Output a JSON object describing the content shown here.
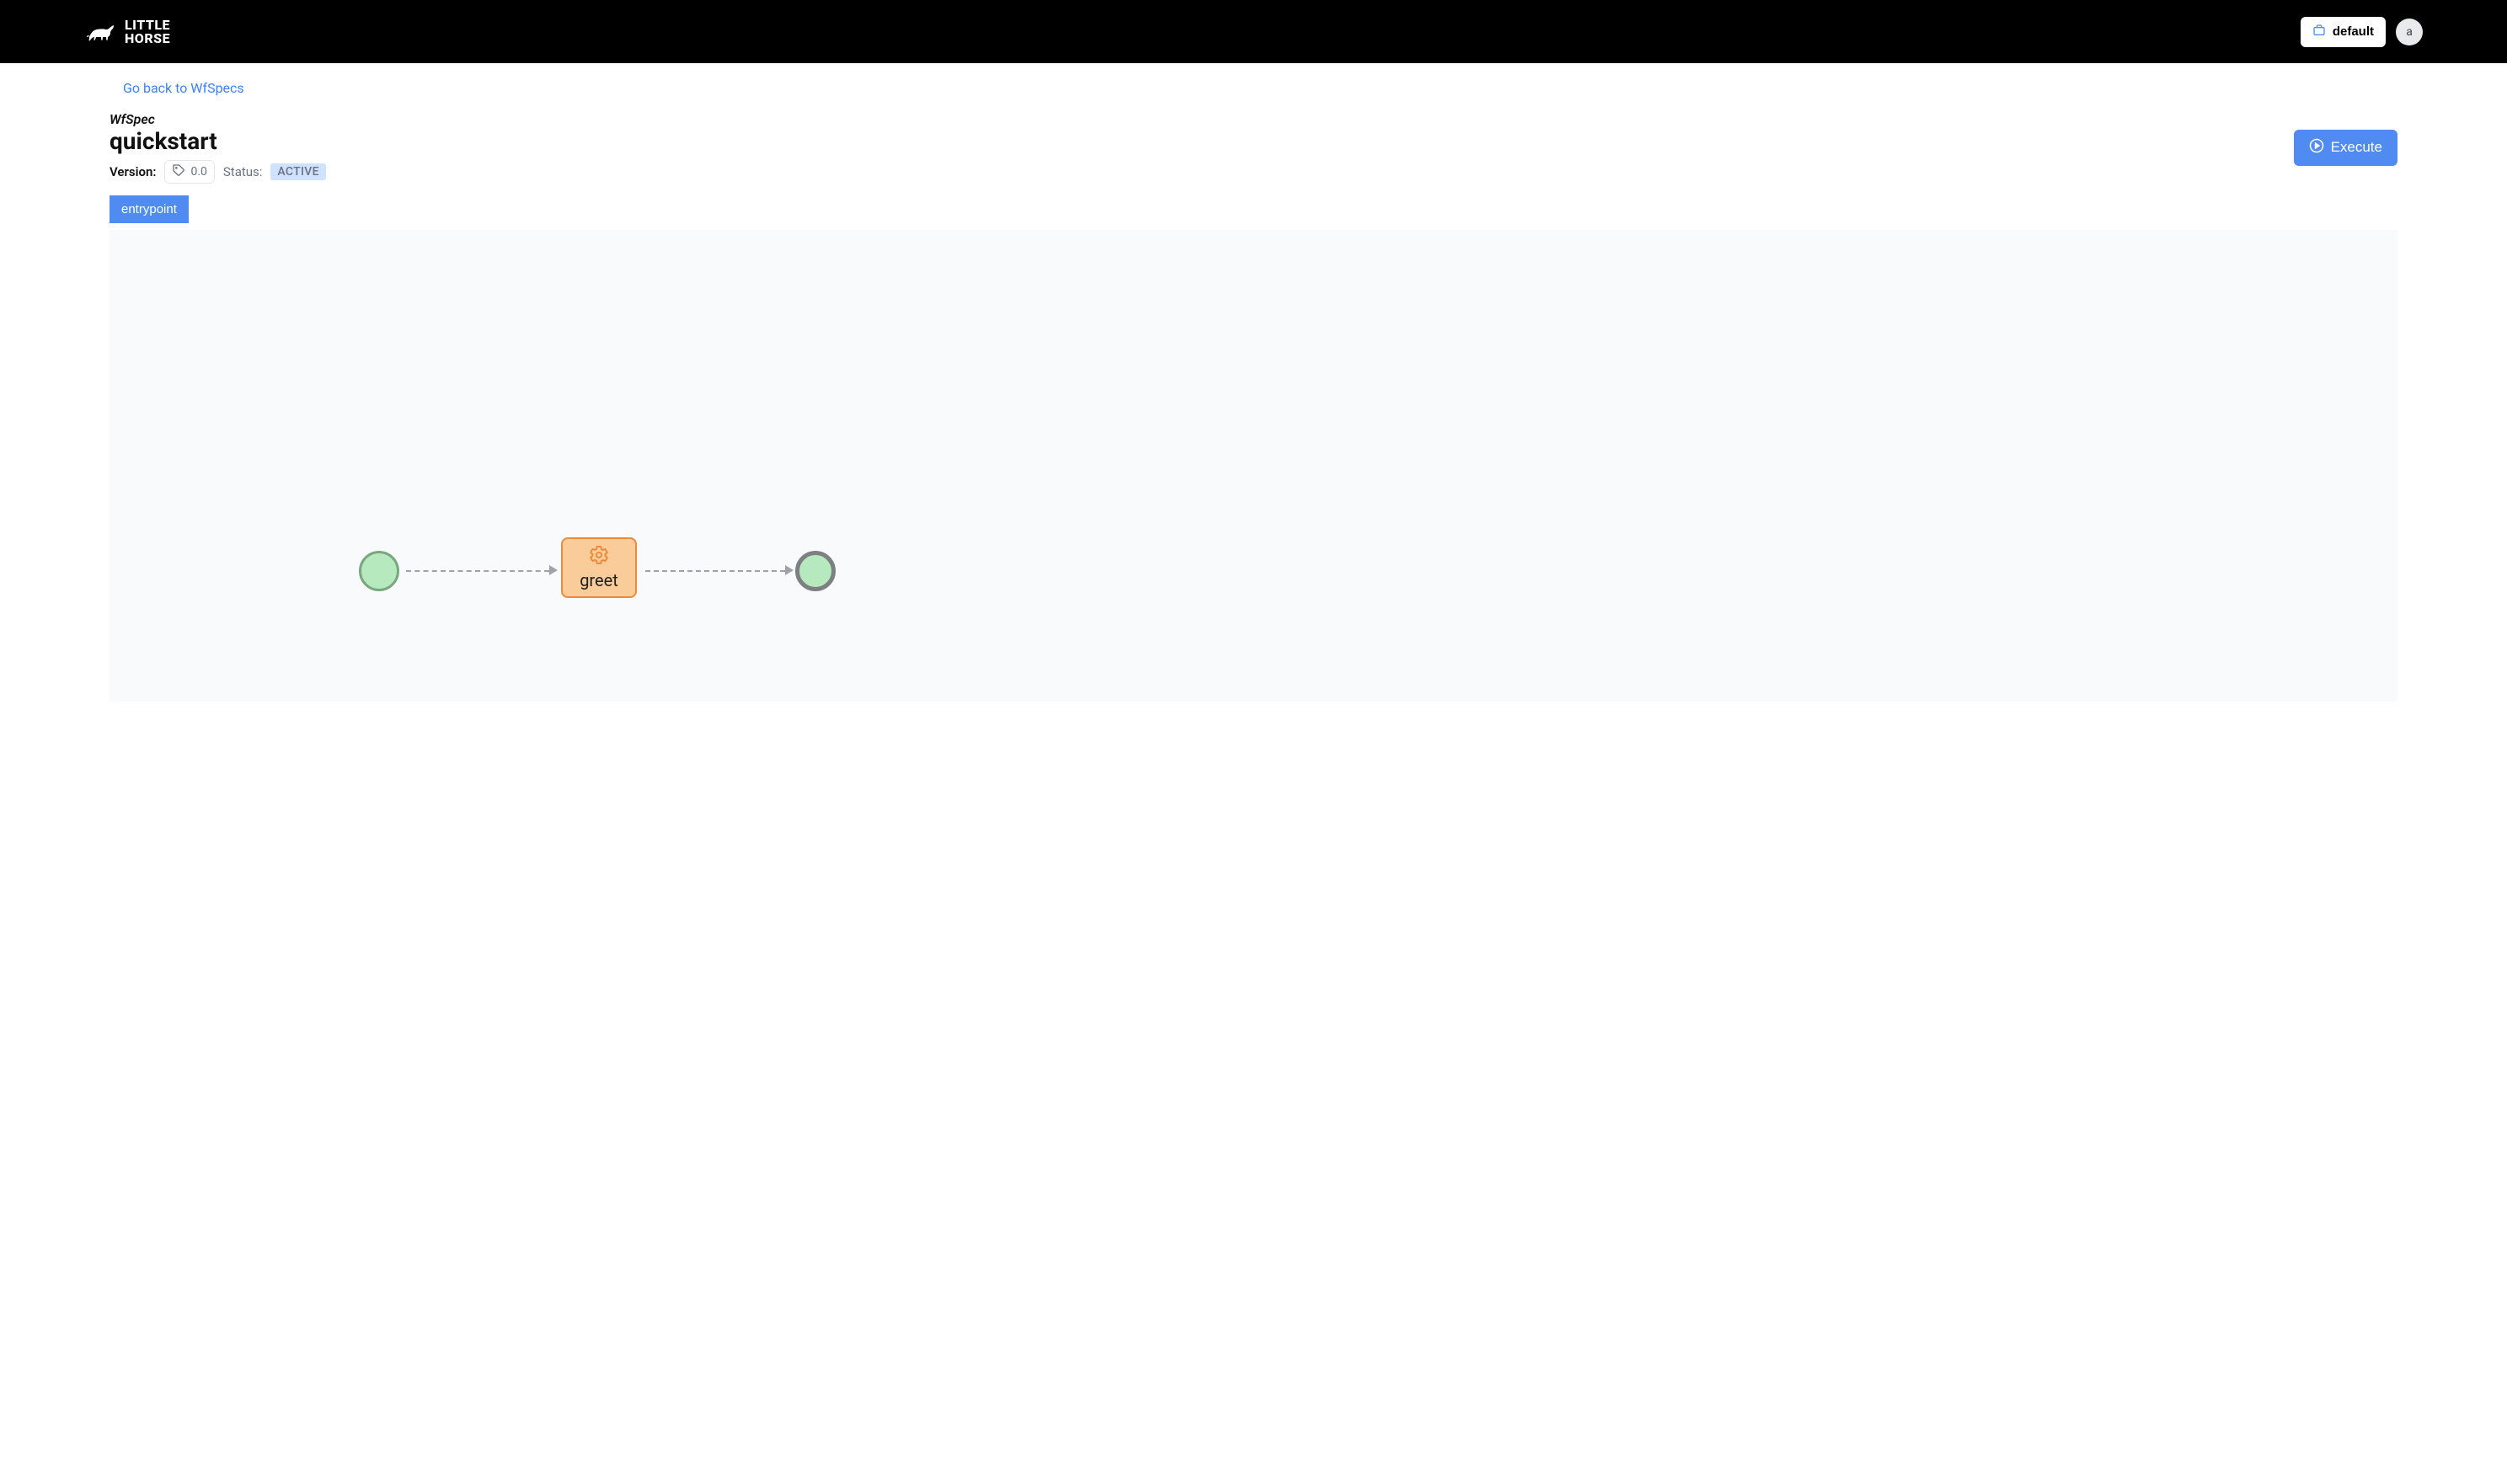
{
  "header": {
    "logo_line1": "LITTLE",
    "logo_line2": "HORSE",
    "workspace_label": "default",
    "avatar_initial": "a"
  },
  "nav": {
    "back_link": "Go back to WfSpecs"
  },
  "page": {
    "type_label": "WfSpec",
    "title": "quickstart",
    "version_label": "Version:",
    "version_value": "0.0",
    "status_label": "Status:",
    "status_value": "ACTIVE",
    "execute_label": "Execute"
  },
  "tabs": [
    {
      "label": "entrypoint"
    }
  ],
  "workflow": {
    "task_node_label": "greet"
  }
}
